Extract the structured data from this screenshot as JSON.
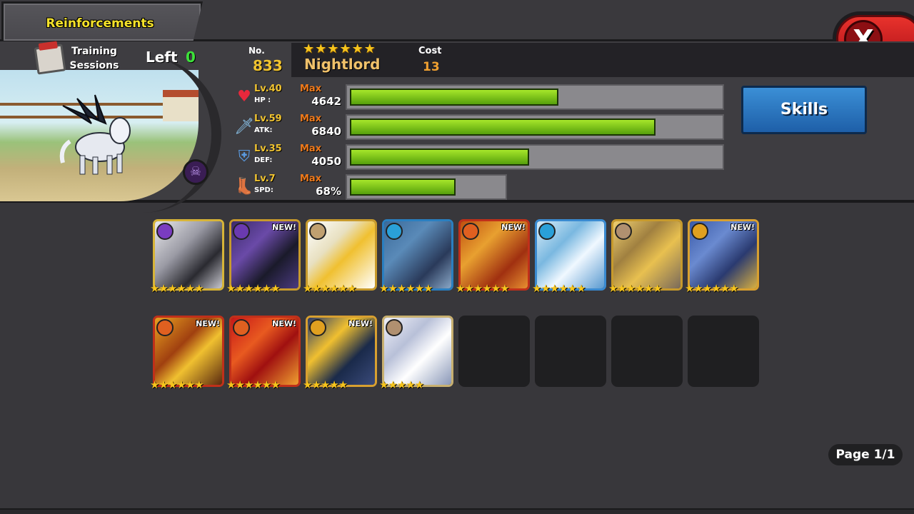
{
  "title": "Reinforcements",
  "close_label": "X",
  "training": {
    "label_line1": "Training",
    "label_line2": "Sessions",
    "left_label": "Left",
    "left_value": "0"
  },
  "monster": {
    "no_label": "No.",
    "no_value": "833",
    "stars": "★★★★★★",
    "name": "Nightlord",
    "cost_label": "Cost",
    "cost_value": "13",
    "stats": [
      {
        "icon": "heart-icon",
        "glyph": "♥",
        "color": "#e8283c",
        "level": "Lv.40",
        "abbr": "HP :",
        "max": "Max",
        "value": "4642",
        "fill": 0.56
      },
      {
        "icon": "sword-icon",
        "glyph": "🗡",
        "color": "#8ec8f0",
        "level": "Lv.59",
        "abbr": "ATK:",
        "max": "Max",
        "value": "6840",
        "fill": 0.82
      },
      {
        "icon": "shield-icon",
        "glyph": "⛨",
        "color": "#5a9ae0",
        "level": "Lv.35",
        "abbr": "DEF:",
        "max": "Max",
        "value": "4050",
        "fill": 0.48
      },
      {
        "icon": "boot-icon",
        "glyph": "👢",
        "color": "#a0642a",
        "level": "Lv.7",
        "abbr": "SPD:",
        "max": "Max",
        "value": "68%",
        "fill": 0.68
      }
    ]
  },
  "skills_label": "Skills",
  "cards": [
    {
      "name": "monster-card-1",
      "element": "dark",
      "elem_color": "#7a3cc0",
      "border": "#d7b438",
      "art": "linear-gradient(135deg,#e9e9ec 0%,#9a9aa4 40%,#2a2a30 70%,#c8c8d0 100%)",
      "new": "",
      "stars": "★★★★★★"
    },
    {
      "name": "monster-card-2",
      "element": "dark",
      "elem_color": "#6a3ab0",
      "border": "#c79a2c",
      "art": "linear-gradient(135deg,#3b2a6a 0%,#6a4aa8 35%,#1a1a2a 65%,#4a3a80 100%)",
      "new": "NEW!",
      "stars": "★★★★★★"
    },
    {
      "name": "monster-card-3",
      "element": "light",
      "elem_color": "#c0a070",
      "border": "#c79a2c",
      "art": "linear-gradient(135deg,#ffffff 0%,#e8e0c0 35%,#f0c030 55%,#ffffff 100%)",
      "new": "",
      "stars": "★★★★★★"
    },
    {
      "name": "monster-card-4",
      "element": "water",
      "elem_color": "#2aa0d8",
      "border": "#2a7fc0",
      "art": "linear-gradient(135deg,#3a6a9a 0%,#5a8ab8 35%,#2a3a5a 70%,#8aa8c8 100%)",
      "new": "",
      "stars": "★★★★★★"
    },
    {
      "name": "monster-card-5",
      "element": "fire",
      "elem_color": "#e06020",
      "border": "#c0301a",
      "art": "linear-gradient(135deg,#c05010 0%,#e8a030 35%,#a03010 70%,#e89030 100%)",
      "new": "NEW!",
      "stars": "★★★★★★"
    },
    {
      "name": "monster-card-6",
      "element": "water",
      "elem_color": "#2aa0d8",
      "border": "#3a8ad0",
      "art": "linear-gradient(135deg,#d8ecf8 0%,#7ab8e0 35%,#f0f8ff 60%,#5a9ad0 100%)",
      "new": "",
      "stars": "★★★★★★"
    },
    {
      "name": "monster-card-7",
      "element": "light",
      "elem_color": "#b09070",
      "border": "#c79a2c",
      "art": "linear-gradient(135deg,#f0d070 0%,#a08040 35%,#e8c050 60%,#7a6a5a 100%)",
      "new": "",
      "stars": "★★★★★★"
    },
    {
      "name": "monster-card-8",
      "element": "thunder",
      "elem_color": "#e0a020",
      "border": "#d8a030",
      "art": "linear-gradient(135deg,#3a5aa8 0%,#6a8ad0 35%,#2a3a70 65%,#d8b040 100%)",
      "new": "NEW!",
      "stars": "★★★★★★"
    },
    {
      "name": "monster-card-9",
      "element": "fire",
      "elem_color": "#e06020",
      "border": "#c0301a",
      "art": "linear-gradient(135deg,#e8a020 0%,#a04010 40%,#f0c030 60%,#5a2a10 100%)",
      "new": "NEW!",
      "stars": "★★★★★★"
    },
    {
      "name": "monster-card-10",
      "element": "fire",
      "elem_color": "#e06020",
      "border": "#c0301a",
      "art": "linear-gradient(135deg,#c81818 0%,#e85a20 35%,#a01010 60%,#f0a030 100%)",
      "new": "NEW!",
      "stars": "★★★★★★"
    },
    {
      "name": "monster-card-11",
      "element": "thunder",
      "elem_color": "#e0a020",
      "border": "#d8a030",
      "art": "linear-gradient(135deg,#2a3a6a 0%,#f0c030 35%,#1a2a4a 65%,#3a4a7a 100%)",
      "new": "NEW!",
      "stars": "★★★★★"
    },
    {
      "name": "monster-card-12",
      "element": "light",
      "elem_color": "#b09070",
      "border": "#c8b070",
      "art": "linear-gradient(135deg,#f0f0f8 0%,#b8c0d8 35%,#ffffff 60%,#8a98b8 100%)",
      "new": "",
      "stars": "★★★★★"
    }
  ],
  "empty_slots": 4,
  "page": "Page 1/1"
}
